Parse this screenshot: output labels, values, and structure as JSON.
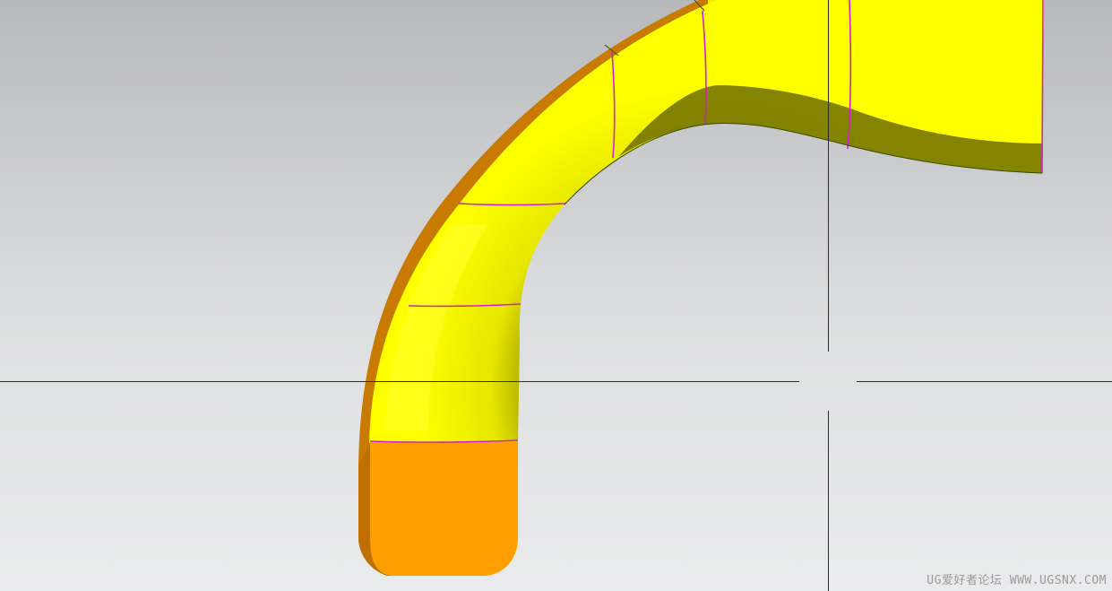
{
  "viewport": {
    "watermark": "UG爱好者论坛 WWW.UGSNX.COM"
  },
  "colors": {
    "background_top": "#b9babc",
    "background_bottom": "#e9eaeb",
    "model_yellow": "#ffff00",
    "model_shadow": "#666600",
    "model_orange_face": "#ffa000",
    "model_orange_edge": "#c97a00",
    "face_boundary": "#d020d0",
    "crosshair": "#2a2a2a"
  },
  "icons": {
    "crosshair": "crosshair-cursor-icon"
  }
}
